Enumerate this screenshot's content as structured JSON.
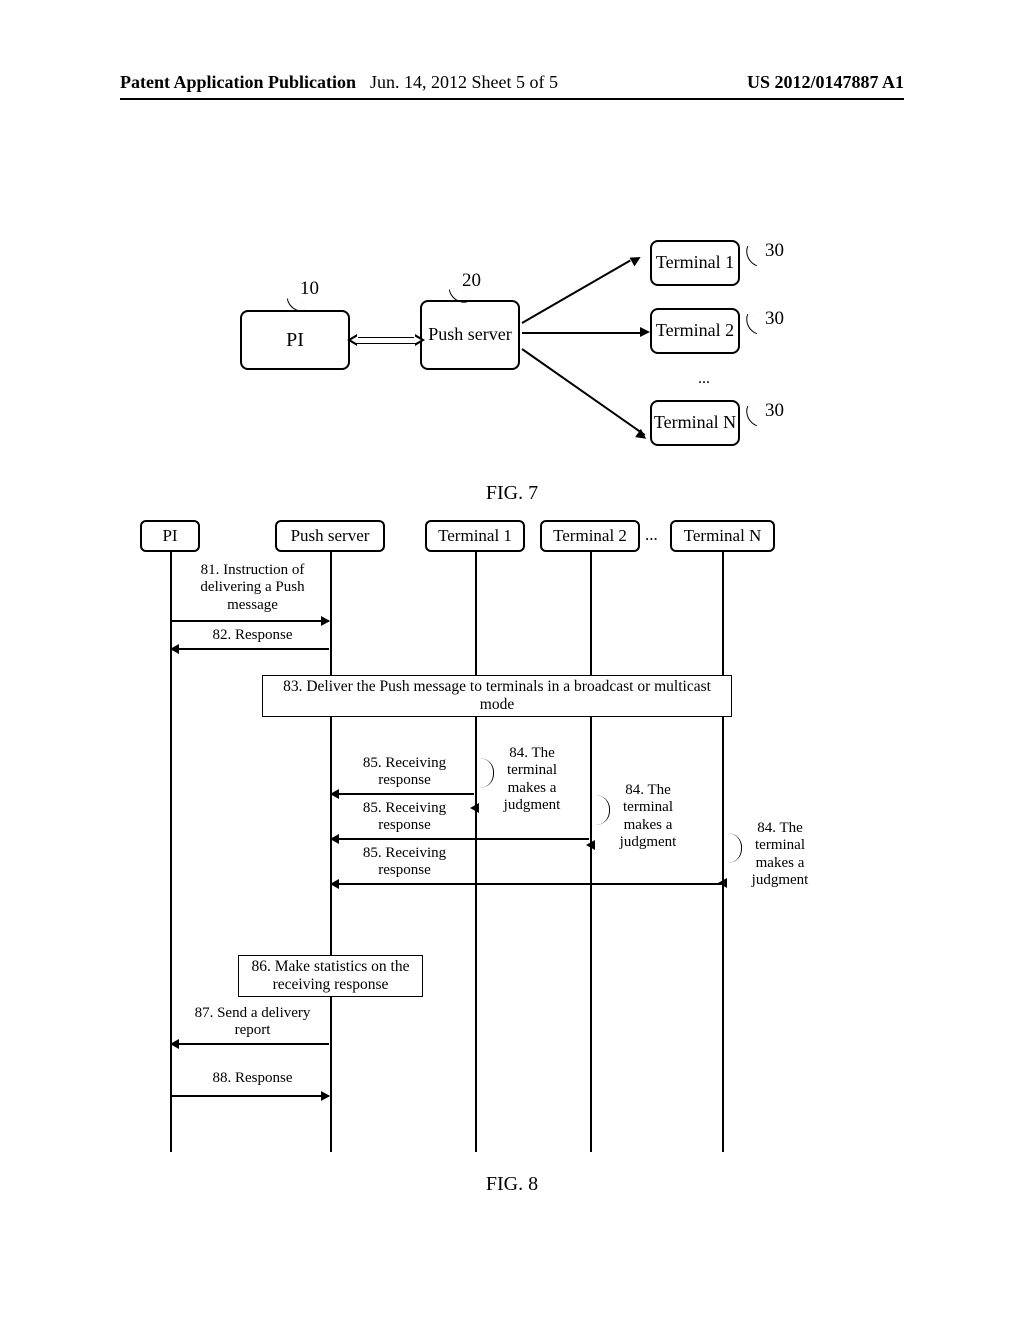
{
  "header": {
    "left": "Patent Application Publication",
    "mid": "Jun. 14, 2012  Sheet 5 of 5",
    "right": "US 2012/0147887 A1"
  },
  "fig7": {
    "pi": "PI",
    "push": "Push server",
    "t1": "Terminal 1",
    "t2": "Terminal 2",
    "tn": "Terminal N",
    "dots": "...",
    "ref10": "10",
    "ref20": "20",
    "ref30a": "30",
    "ref30b": "30",
    "ref30c": "30",
    "caption": "FIG. 7"
  },
  "fig8": {
    "lanes": {
      "pi": "PI",
      "push": "Push server",
      "t1": "Terminal 1",
      "t2": "Terminal 2",
      "dots": "...",
      "tn": "Terminal N"
    },
    "m81": "81. Instruction of delivering a Push message",
    "m82": "82. Response",
    "m83": "83. Deliver the Push message to terminals in a broadcast or multicast mode",
    "m84a": "84. The terminal makes a judgment",
    "m84b": "84. The terminal makes a judgment",
    "m84c": "84. The terminal makes a judgment",
    "m85a": "85. Receiving response",
    "m85b": "85. Receiving response",
    "m85c": "85. Receiving response",
    "m86": "86. Make statistics on the receiving response",
    "m87": "87. Send a delivery report",
    "m88": "88. Response",
    "caption": "FIG. 8"
  }
}
